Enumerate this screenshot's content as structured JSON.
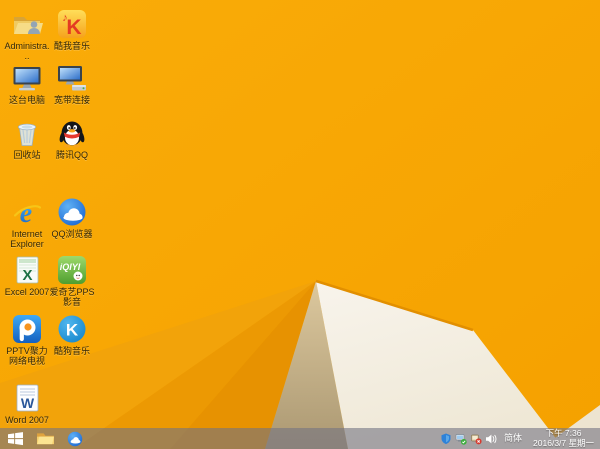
{
  "wallpaper": {
    "base_color": "#F7A704",
    "facet_left_1": "#F2A30A",
    "facet_left_2": "#EC9903",
    "facet_left_3": "#E79201",
    "facet_tan": "#C0AB81",
    "facet_white": "#F4EFE3",
    "facet_cream": "#EDE4D0"
  },
  "desktop": {
    "icons": [
      {
        "id": "admin-folder",
        "label": "Administra..."
      },
      {
        "id": "kuwo-music",
        "label": "酷我音乐"
      },
      {
        "id": "this-pc",
        "label": "这台电脑"
      },
      {
        "id": "broadband",
        "label": "宽带连接"
      },
      {
        "id": "recycle-bin",
        "label": "回收站"
      },
      {
        "id": "tencent-qq",
        "label": "腾讯QQ"
      },
      {
        "id": "internet-explorer",
        "label": "Internet Explorer"
      },
      {
        "id": "qq-browser",
        "label": "QQ浏览器"
      },
      {
        "id": "excel-2007",
        "label": "Excel 2007"
      },
      {
        "id": "iqiyi-pps",
        "label": "爱奇艺PPS影音"
      },
      {
        "id": "pptv",
        "label": "PPTV聚力网络电视"
      },
      {
        "id": "kugou-music",
        "label": "酷狗音乐"
      },
      {
        "id": "word-2007",
        "label": "Word 2007"
      }
    ]
  },
  "taskbar": {
    "pinned": [
      {
        "id": "start",
        "name": "start-button"
      },
      {
        "id": "file-explorer",
        "name": "file-explorer-button"
      },
      {
        "id": "qq-browser-task",
        "name": "qq-browser-button"
      }
    ],
    "tray": {
      "icons": [
        {
          "id": "security-shield",
          "name": "security-shield-icon"
        },
        {
          "id": "network-status",
          "name": "network-ok-icon"
        },
        {
          "id": "device-alert",
          "name": "device-error-icon"
        },
        {
          "id": "volume",
          "name": "volume-icon"
        }
      ],
      "input_indicator": "简体",
      "time": "下午 7:36",
      "date": "2016/3/7 星期一"
    }
  }
}
